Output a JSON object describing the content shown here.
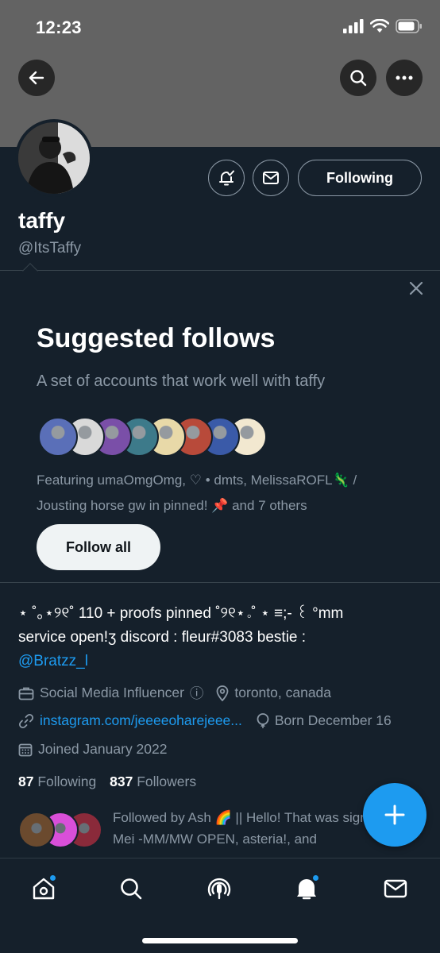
{
  "status_bar": {
    "time": "12:23"
  },
  "profile": {
    "display_name": "taffy",
    "handle": "@ItsTaffy",
    "following_button": "Following"
  },
  "suggested": {
    "title": "Suggested follows",
    "subtitle": "A set of accounts that work well with taffy",
    "featuring_line1": "Featuring umaOmgOmg, ♡ • dmts, MelissaROFL🦎 /",
    "featuring_line2": "Jousting horse gw in pinned! 📌 and 7 others",
    "follow_all": "Follow all",
    "avatar_colors": [
      "#5a6fb8",
      "#d9d9d9",
      "#7a4fa8",
      "#3d7a8a",
      "#e8d9a8",
      "#b84a3a",
      "#3a5aa8",
      "#f2e8d0"
    ]
  },
  "bio": {
    "line1": "⋆ ˚｡⋆୨୧˚ 110 + proofs pinned ˚୨୧⋆｡˚ ⋆ ≡;- ꒰ °mm",
    "line2": "service open!ʒ discord : fleur#3083 bestie :",
    "mention": "@Bratzz_l"
  },
  "meta": {
    "category": "Social Media Influencer",
    "info_symbol": "ⓘ",
    "location": "toronto, canada",
    "website": "instagram.com/jeeeeoharejeee...",
    "birthday": "Born December 16",
    "joined": "Joined January 2022"
  },
  "counts": {
    "following_count": "87",
    "following_label": "Following",
    "followers_count": "837",
    "followers_label": "Followers"
  },
  "followed_by": {
    "text": "Followed by Ash 🌈 || Hello! That was sign!, Mei -MM/MW OPEN, asteria!, and",
    "avatar_colors": [
      "#6b4a2e",
      "#d94fd9",
      "#8a2a3a"
    ]
  },
  "tabs": [
    "home",
    "search",
    "spaces",
    "notifications",
    "messages"
  ]
}
